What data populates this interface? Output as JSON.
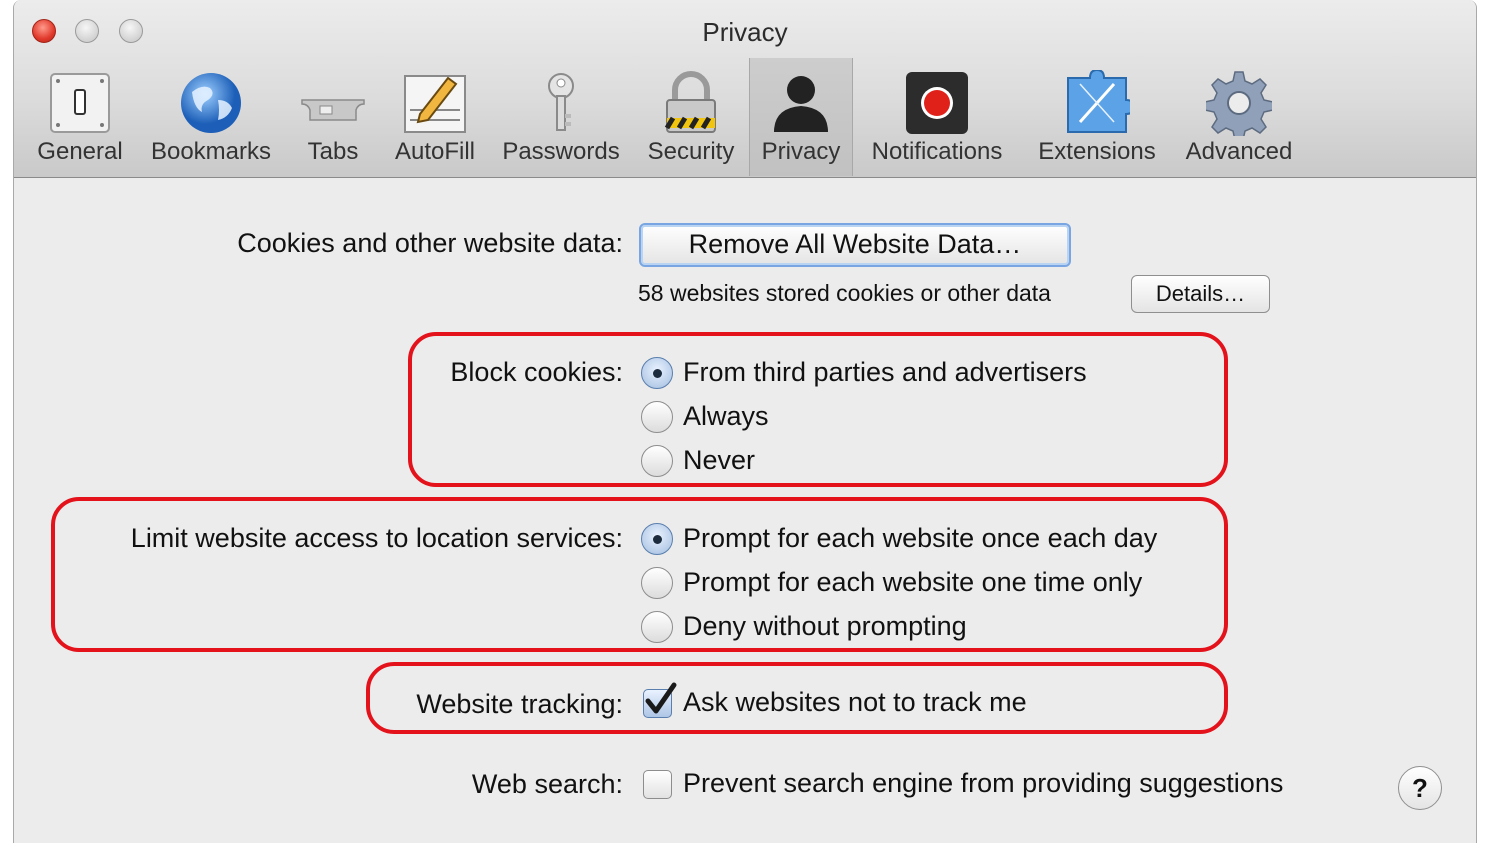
{
  "window": {
    "title": "Privacy"
  },
  "toolbar": {
    "tabs": [
      {
        "label": "General",
        "icon": "general-switch-icon"
      },
      {
        "label": "Bookmarks",
        "icon": "globe-icon"
      },
      {
        "label": "Tabs",
        "icon": "tabs-icon"
      },
      {
        "label": "AutoFill",
        "icon": "autofill-pencil-icon"
      },
      {
        "label": "Passwords",
        "icon": "key-icon"
      },
      {
        "label": "Security",
        "icon": "padlock-icon"
      },
      {
        "label": "Privacy",
        "icon": "person-silhouette-icon"
      },
      {
        "label": "Notifications",
        "icon": "notification-record-icon"
      },
      {
        "label": "Extensions",
        "icon": "puzzle-compass-icon"
      },
      {
        "label": "Advanced",
        "icon": "gear-icon"
      }
    ],
    "selected": "Privacy"
  },
  "cookies": {
    "label": "Cookies and other website data:",
    "remove_button": "Remove All Website Data…",
    "stored_text": "58 websites stored cookies or other data",
    "details_button": "Details…"
  },
  "block_cookies": {
    "label": "Block cookies:",
    "options": [
      {
        "label": "From third parties and advertisers",
        "selected": true
      },
      {
        "label": "Always",
        "selected": false
      },
      {
        "label": "Never",
        "selected": false
      }
    ]
  },
  "location": {
    "label": "Limit website access to location services:",
    "options": [
      {
        "label": "Prompt for each website once each day",
        "selected": true
      },
      {
        "label": "Prompt for each website one time only",
        "selected": false
      },
      {
        "label": "Deny without prompting",
        "selected": false
      }
    ]
  },
  "tracking": {
    "label": "Website tracking:",
    "checkbox_label": "Ask websites not to track me",
    "checked": true
  },
  "web_search": {
    "label": "Web search:",
    "checkbox_label": "Prevent search engine from providing suggestions",
    "checked": false,
    "help": "?"
  },
  "colors": {
    "highlight": "#e3121b",
    "radio_selected": "#1d2b3f",
    "window_bg": "#ececec"
  }
}
